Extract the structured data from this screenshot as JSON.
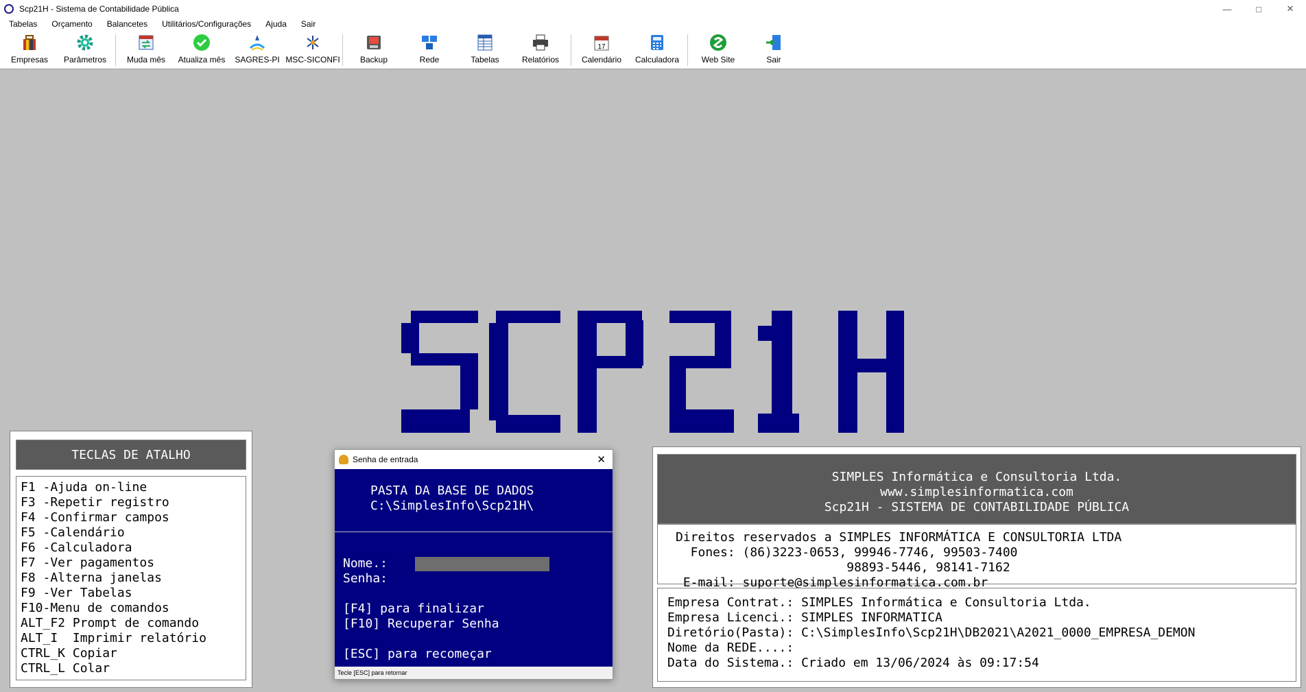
{
  "window": {
    "title": "Scp21H - Sistema de Contabilidade Pública"
  },
  "menu": [
    "Tabelas",
    "Orçamento",
    "Balancetes",
    "Utilitários/Configurações",
    "Ajuda",
    "Sair"
  ],
  "toolbar": [
    {
      "label": "Empresas",
      "icon": "briefcase-icon"
    },
    {
      "label": "Parâmetros",
      "icon": "gear-icon"
    },
    {
      "label": "Muda mês",
      "icon": "switch-month-icon"
    },
    {
      "label": "Atualiza mês",
      "icon": "checkmark-icon"
    },
    {
      "label": "SAGRES-PI",
      "icon": "sagres-logo-icon"
    },
    {
      "label": "MSC-SICONFI",
      "icon": "siconfi-logo-icon"
    },
    {
      "label": "Backup",
      "icon": "backup-icon"
    },
    {
      "label": "Rede",
      "icon": "network-icon"
    },
    {
      "label": "Tabelas",
      "icon": "table-icon"
    },
    {
      "label": "Relatórios",
      "icon": "printer-icon"
    },
    {
      "label": "Calendário",
      "icon": "calendar-icon"
    },
    {
      "label": "Calculadora",
      "icon": "calculator-icon"
    },
    {
      "label": "Web Site",
      "icon": "globe-icon"
    },
    {
      "label": "Sair",
      "icon": "exit-door-icon"
    }
  ],
  "logo_text": "SCP21H",
  "shortcuts": {
    "title": "TECLAS DE ATALHO",
    "items": [
      "F1 -Ajuda on-line",
      "F3 -Repetir registro",
      "F4 -Confirmar campos",
      "F5 -Calendário",
      "F6 -Calculadora",
      "F7 -Ver pagamentos",
      "F8 -Alterna janelas",
      "F9 -Ver Tabelas",
      "F10-Menu de comandos",
      "ALT_F2 Prompt de comando",
      "ALT_I  Imprimir relatório",
      "CTRL_K Copiar",
      "CTRL_L Colar"
    ]
  },
  "login": {
    "title": "Senha de entrada",
    "folder_heading": "PASTA DA BASE DE DADOS",
    "folder_path": "C:\\SimplesInfo\\Scp21H\\",
    "name_label": "Nome.:",
    "name_value": "",
    "password_label": "Senha:",
    "f4_hint": "[F4] para finalizar",
    "f10_hint": "[F10] Recuperar Senha",
    "esc_hint": "[ESC] para recomeçar",
    "status": "Tecle [ESC] para retornar"
  },
  "info": {
    "header": [
      "SIMPLES Informática e Consultoria Ltda.",
      "www.simplesinformatica.com",
      "Scp21H - SISTEMA DE CONTABILIDADE PÚBLICA"
    ],
    "contact": [
      "Direitos reservados a SIMPLES INFORMÁTICA E CONSULTORIA LTDA",
      "  Fones: (86)3223-0653, 99946-7746, 99503-7400",
      "                       98893-5446, 98141-7162",
      " E-mail: suporte@simplesinformatica.com.br"
    ],
    "system": [
      "Empresa Contrat.: SIMPLES Informática e Consultoria Ltda.",
      "Empresa Licenci.: SIMPLES INFORMATICA",
      "Diretório(Pasta): C:\\SimplesInfo\\Scp21H\\DB2021\\A2021_0000_EMPRESA_DEMON",
      "Nome da REDE....:",
      "Data do Sistema.: Criado em 13/06/2024 às 09:17:54"
    ]
  },
  "colors": {
    "navy": "#000080",
    "panel_header": "#5a5a5a",
    "background": "#c0c0c0"
  }
}
